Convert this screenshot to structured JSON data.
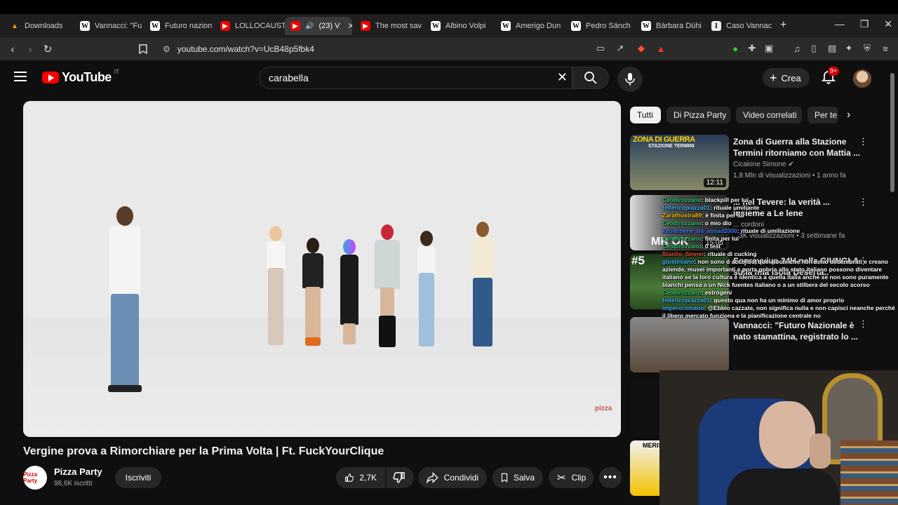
{
  "browser": {
    "tabs": [
      {
        "title": "Downloads",
        "icon": "download-icon",
        "active": false
      },
      {
        "title": "Vannacci: \"Fu",
        "icon": "wikipedia-icon",
        "active": false
      },
      {
        "title": "Futuro nazion",
        "icon": "wikipedia-icon",
        "active": false
      },
      {
        "title": "LOLLOCAUST",
        "icon": "youtube-icon",
        "active": false
      },
      {
        "title": "(23) V",
        "icon": "youtube-icon",
        "active": true
      },
      {
        "title": "The most sav",
        "icon": "youtube-icon",
        "active": false
      },
      {
        "title": "Albino Volpi",
        "icon": "wikipedia-icon",
        "active": false
      },
      {
        "title": "Amerigo Dun",
        "icon": "wikipedia-icon",
        "active": false
      },
      {
        "title": "Pedro Sánch",
        "icon": "wikipedia-icon",
        "active": false
      },
      {
        "title": "Bàrbara Dühi",
        "icon": "wikipedia-icon",
        "active": false
      },
      {
        "title": "Caso Vannac",
        "icon": "wiki-letter-icon",
        "active": false
      }
    ],
    "url": "youtube.com/watch?v=UcB48p5fbk4",
    "shield_badge": "1"
  },
  "youtube": {
    "logo_text": "YouTube",
    "country_code": "IT",
    "search_value": "carabella",
    "create_label": "Crea",
    "notifications_badge": "9+"
  },
  "video": {
    "title": "Vergine prova a Rimorchiare per la Prima Volta | Ft. FuckYourClique",
    "watermark": "pizza",
    "channel": {
      "name": "Pizza Party",
      "subscribers": "98,6K iscritti",
      "avatar_text": "Pizza Party"
    },
    "subscribe_label": "Iscriviti",
    "like_count": "2,7K",
    "share_label": "Condividi",
    "save_label": "Salva",
    "clip_label": "Clip"
  },
  "chips": [
    "Tutti",
    "Di Pizza Party",
    "Video correlati",
    "Per te"
  ],
  "recommendations": [
    {
      "title": "Zona di Guerra alla Stazione Termini ritorniamo con Mattia ...",
      "channel": "Cicalone Simone",
      "meta": "1,8 Mln di visualizzazioni • 1 anno fa",
      "duration": "12:11",
      "thumb_text": "ZONA DI GUERRA",
      "thumb_subtext": "STAZIONE TERMINI"
    },
    {
      "title": "... nel Tevere: la verità ... insieme a Le lene",
      "channel": "... cordoni",
      "meta": "...3K visualizzazioni • 3 settimane fa",
      "duration": "15:05",
      "thumb_text": "MR OK",
      "thumb_subtext": "PATO"
    },
    {
      "title": "Sopravvivo 24H nella GIUNGLA sulla mia Isola Deserta..",
      "channel": "",
      "meta": "",
      "duration": "",
      "thumb_text": "#5",
      "thumb_subtext": ""
    },
    {
      "title": "Vannacci: \"Futuro Nazionale è nato stamattina, registrato lo ...",
      "channel": "",
      "meta": "",
      "duration": "",
      "thumb_text": "",
      "thumb_subtext": ""
    },
    {
      "title": "",
      "channel": "",
      "meta": "",
      "duration": "",
      "thumb_text": "",
      "thumb_subtext": ""
    },
    {
      "title": "",
      "channel": "",
      "meta": "",
      "duration": "",
      "thumb_text": "MERIS",
      "thumb_subtext": ""
    }
  ],
  "chat": [
    {
      "user": "Ceodirozzano",
      "user_color": "#2ecc71",
      "text": ": blackpill per lui"
    },
    {
      "user": "federicopiazza01",
      "user_color": "#3fb6ff",
      "text": ": rituale umiliante"
    },
    {
      "user": "Zarathustra89",
      "user_color": "#f1c40f",
      "text": ": è finita per lui"
    },
    {
      "user": "Ceodirozzano",
      "user_color": "#2ecc71",
      "text": ": o mio dio"
    },
    {
      "user": "kebabbene_da_assad2000",
      "user_color": "#3f7fff",
      "text": ": rituale di umiliazione"
    },
    {
      "user": "Ceodirozzano",
      "user_color": "#2ecc71",
      "text": ": finita per lui"
    },
    {
      "user": "Ceodirozzano",
      "user_color": "#2ecc71",
      "text": ": 0 test"
    },
    {
      "user": "Stanlio_Sinner",
      "user_color": "#e74c3c",
      "text": ": rituale di cucking"
    },
    {
      "user": "giustiniano",
      "user_color": "#3fb6ff",
      "text": ": non sono d accordo, quei pochi che non sono decerebrati e creano aziende, musei importanti e porta gobria allo stato italiano possono diventare italiano se la loro cultura è identica a quella italia anche se non sono puramente bianchi pensa a un Nick fuentes italiano o a un stilbera del secolo scorso"
    },
    {
      "user": "Ceodirozzano",
      "user_color": "#2ecc71",
      "text": ": estrogeni"
    },
    {
      "user": "federicopiazza01",
      "user_color": "#3fb6ff",
      "text": ": questo qua non ha un minimo di amor proprio"
    },
    {
      "user": "imperoromano",
      "user_color": "#3fb6ff",
      "text": ": @Ebbio cazzate, non significa nulla e non capisci neanche perchè il libero mercato funziona e la pianificazione centrale no"
    }
  ],
  "colors": {
    "youtube_red": "#ff0000",
    "background": "#0f0f0f",
    "chip_bg": "#272727"
  }
}
